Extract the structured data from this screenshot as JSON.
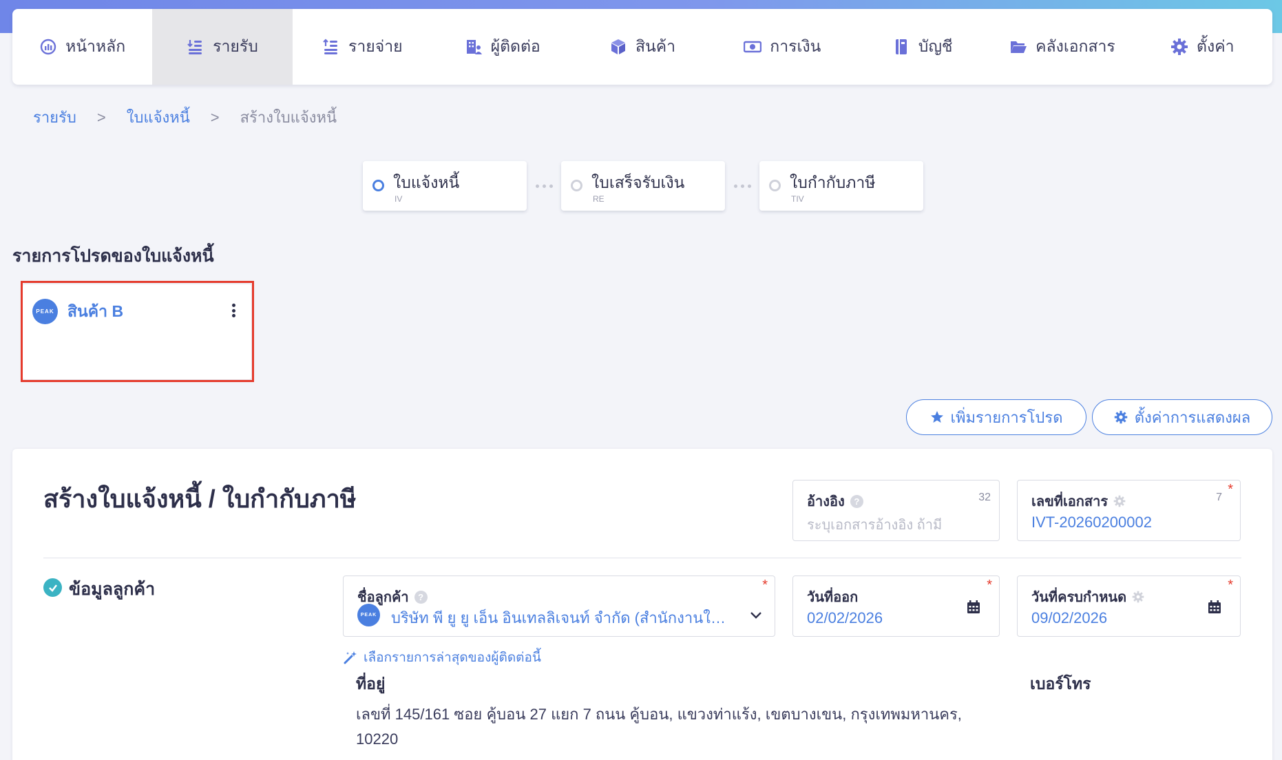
{
  "nav": {
    "items": [
      {
        "label": "หน้าหลัก",
        "icon": "dashboard-gauge-icon"
      },
      {
        "label": "รายรับ",
        "icon": "income-list-icon"
      },
      {
        "label": "รายจ่าย",
        "icon": "expense-list-icon"
      },
      {
        "label": "ผู้ติดต่อ",
        "icon": "contacts-building-icon"
      },
      {
        "label": "สินค้า",
        "icon": "product-box-icon"
      },
      {
        "label": "การเงิน",
        "icon": "money-bill-icon"
      },
      {
        "label": "บัญชี",
        "icon": "accounting-book-icon"
      },
      {
        "label": "คลังเอกสาร",
        "icon": "folder-open-icon"
      },
      {
        "label": "ตั้งค่า",
        "icon": "gear-icon"
      }
    ],
    "active_index": 1
  },
  "breadcrumb": {
    "items": [
      "รายรับ",
      "ใบแจ้งหนี้"
    ],
    "separator": ">",
    "current": "สร้างใบแจ้งหนี้"
  },
  "steps": [
    {
      "label": "ใบแจ้งหนี้",
      "code": "IV"
    },
    {
      "label": "ใบเสร็จรับเงิน",
      "code": "RE"
    },
    {
      "label": "ใบกำกับภาษี",
      "code": "TIV"
    }
  ],
  "favorites": {
    "title": "รายการโปรดของใบแจ้งหนี้",
    "items": [
      {
        "name": "สินค้า B",
        "avatar_text": "PEAK"
      }
    ]
  },
  "actions": {
    "add_favorite": "เพิ่มรายการโปรด",
    "display_settings": "ตั้งค่าการแสดงผล"
  },
  "form": {
    "title": "สร้างใบแจ้งหนี้ / ใบกำกับภาษี",
    "reference": {
      "label": "อ้างอิง",
      "count": "32",
      "placeholder": "ระบุเอกสารอ้างอิง ถ้ามี"
    },
    "doc_number": {
      "label": "เลขที่เอกสาร",
      "count": "7",
      "value": "IVT-20260200002",
      "required": "*"
    },
    "customer_section": "ข้อมูลลูกค้า",
    "customer": {
      "label": "ชื่อลูกค้า",
      "value": "บริษัท พี ยู ยู เอ็น อินเทลลิเจนท์ จำกัด (สำนักงานใหญ่)",
      "avatar_text": "PEAK",
      "required": "*"
    },
    "issue_date": {
      "label": "วันที่ออก",
      "value": "02/02/2026",
      "required": "*"
    },
    "due_date": {
      "label": "วันที่ครบกำหนด",
      "value": "09/02/2026",
      "required": "*"
    },
    "latest_link": "เลือกรายการล่าสุดของผู้ติดต่อนี้",
    "address_label": "ที่อยู่",
    "address": "เลขที่ 145/161 ซอย คู้บอน 27 แยก 7 ถนน คู้บอน, แขวงท่าแร้ง, เขตบางเขน, กรุงเทพมหานคร, 10220",
    "phone_label": "เบอร์โทร"
  },
  "colors": {
    "accent": "#4a7fe0",
    "required": "#e53a2c",
    "highlight_border": "#e53a2c",
    "check": "#3bb3c3"
  }
}
